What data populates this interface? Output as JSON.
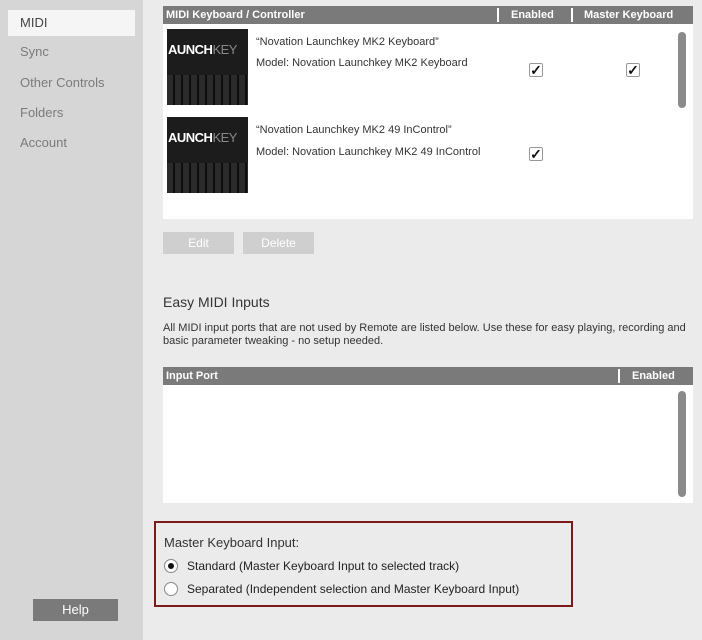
{
  "sidebar": {
    "items": [
      {
        "label": "MIDI",
        "active": true
      },
      {
        "label": "Sync",
        "active": false
      },
      {
        "label": "Other Controls",
        "active": false
      },
      {
        "label": "Folders",
        "active": false
      },
      {
        "label": "Account",
        "active": false
      }
    ],
    "help_label": "Help"
  },
  "devices_table": {
    "columns": [
      "MIDI Keyboard / Controller",
      "Enabled",
      "Master Keyboard"
    ],
    "rows": [
      {
        "thumb_title_a": "AUNCH",
        "thumb_title_b": "KEY",
        "thumb_brand": "novation",
        "name": "“Novation Launchkey MK2 Keyboard”",
        "model": "Model: Novation Launchkey MK2 Keyboard",
        "enabled": true,
        "master": true
      },
      {
        "thumb_title_a": "AUNCH",
        "thumb_title_b": "KEY",
        "thumb_brand": "novation",
        "name": "“Novation Launchkey MK2 49 InControl”",
        "model": "Model: Novation Launchkey MK2 49 InControl",
        "enabled": true,
        "master": false
      }
    ],
    "check_glyph": "✓"
  },
  "buttons": {
    "edit": "Edit",
    "delete": "Delete"
  },
  "easy_midi": {
    "title": "Easy MIDI Inputs",
    "description": "All MIDI input ports that are not used by Remote are listed below. Use these for easy playing, recording and basic parameter tweaking - no setup needed.",
    "columns": [
      "Input Port",
      "Enabled"
    ]
  },
  "master_keyboard": {
    "title": "Master Keyboard Input:",
    "options": [
      {
        "label": "Standard (Master Keyboard Input to selected track)",
        "selected": true
      },
      {
        "label": "Separated (Independent selection and Master Keyboard Input)",
        "selected": false
      }
    ]
  },
  "colors": {
    "accent_border": "#7b1a1a",
    "header_bg": "#7a7a7a",
    "sidebar_bg": "#d6d6d6"
  }
}
